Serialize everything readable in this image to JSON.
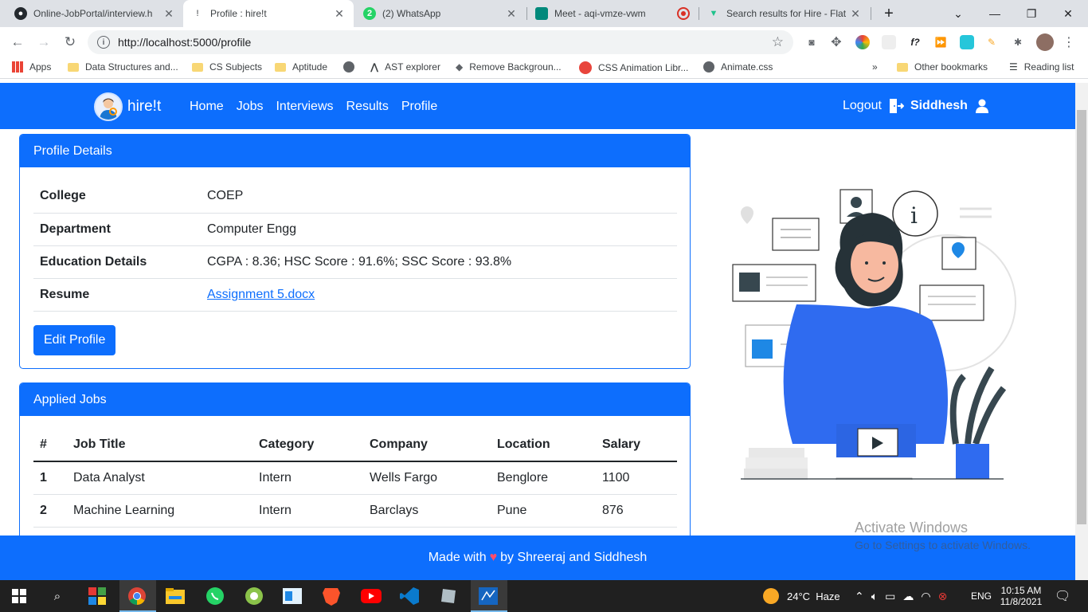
{
  "browser": {
    "tabs": [
      {
        "title": "Online-JobPortal/interview.h",
        "icon": "github-icon",
        "active": false
      },
      {
        "title": "Profile : hire!t",
        "icon": "page-icon",
        "active": true
      },
      {
        "title": "(2) WhatsApp",
        "icon": "whatsapp-icon",
        "badge": "2",
        "active": false
      },
      {
        "title": "Meet - aqi-vmze-vwm",
        "icon": "meet-icon",
        "active": false
      },
      {
        "title": "Search results for Hire - Flat",
        "icon": "flaticon-icon",
        "active": false
      }
    ],
    "new_tab": "+",
    "url": "http://localhost:5000/profile",
    "bookmarks": [
      {
        "label": "Apps",
        "icon": "apps-grid-icon"
      },
      {
        "label": "Data Structures and...",
        "icon": "folder-icon"
      },
      {
        "label": "CS Subjects",
        "icon": "folder-icon"
      },
      {
        "label": "Aptitude",
        "icon": "folder-icon"
      },
      {
        "label": "",
        "icon": "globe-icon"
      },
      {
        "label": "AST explorer",
        "icon": "ast-icon"
      },
      {
        "label": "Remove Backgroun...",
        "icon": "layers-icon"
      },
      {
        "label": "CSS Animation Libr...",
        "icon": "animation-icon"
      },
      {
        "label": "Animate.css",
        "icon": "globe-icon"
      }
    ],
    "more_bookmarks": "»",
    "other_bookmarks": "Other bookmarks",
    "reading_list": "Reading list"
  },
  "site": {
    "brand": "hire!t",
    "nav": [
      "Home",
      "Jobs",
      "Interviews",
      "Results",
      "Profile"
    ],
    "logout": "Logout",
    "user": "Siddhesh",
    "accent": "#0d6efd"
  },
  "profile": {
    "header": "Profile Details",
    "rows": [
      {
        "label": "College",
        "value": "COEP"
      },
      {
        "label": "Department",
        "value": "Computer Engg"
      },
      {
        "label": "Education Details",
        "value": "CGPA : 8.36; HSC Score : 91.6%; SSC Score : 93.8%"
      },
      {
        "label": "Resume",
        "value": "Assignment 5.docx"
      }
    ],
    "edit_button": "Edit Profile"
  },
  "applied_jobs": {
    "header": "Applied Jobs",
    "columns": [
      "#",
      "Job Title",
      "Category",
      "Company",
      "Location",
      "Salary"
    ],
    "rows": [
      [
        "1",
        "Data Analyst",
        "Intern",
        "Wells Fargo",
        "Benglore",
        "1100"
      ],
      [
        "2",
        "Machine Learning",
        "Intern",
        "Barclays",
        "Pune",
        "876"
      ]
    ]
  },
  "footer": {
    "prefix": "Made with",
    "heart": "♥",
    "suffix": "by Shreeraj and Siddhesh"
  },
  "watermark": {
    "line1": "Activate Windows",
    "line2": "Go to Settings to activate Windows."
  },
  "taskbar": {
    "weather": "24°C  Haze",
    "lang": "ENG",
    "time": "10:15 AM",
    "date": "11/8/2021"
  }
}
